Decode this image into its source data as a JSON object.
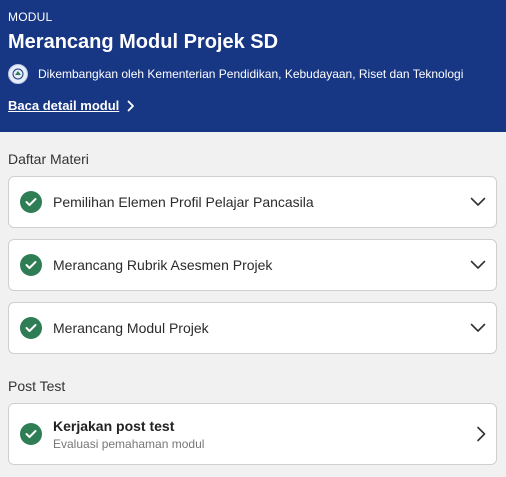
{
  "header": {
    "eyebrow": "MODUL",
    "title": "Merancang Modul Projek SD",
    "developer": "Dikembangkan oleh Kementerian Pendidikan, Kebudayaan, Riset dan Teknologi",
    "detail_link": "Baca detail modul"
  },
  "materials": {
    "section_title": "Daftar Materi",
    "items": [
      {
        "label": "Pemilihan Elemen Profil Pelajar Pancasila"
      },
      {
        "label": "Merancang Rubrik Asesmen Projek"
      },
      {
        "label": "Merancang Modul Projek"
      }
    ]
  },
  "post_test": {
    "section_title": "Post Test",
    "title": "Kerjakan post test",
    "subtitle": "Evaluasi pemahaman modul"
  },
  "colors": {
    "header_bg": "#173684",
    "check_green": "#2f7d55",
    "page_bg": "#f1f1f1"
  },
  "icons": {
    "status": "check-circle-icon",
    "expand": "chevron-down-icon",
    "link": "chevron-right-icon"
  }
}
